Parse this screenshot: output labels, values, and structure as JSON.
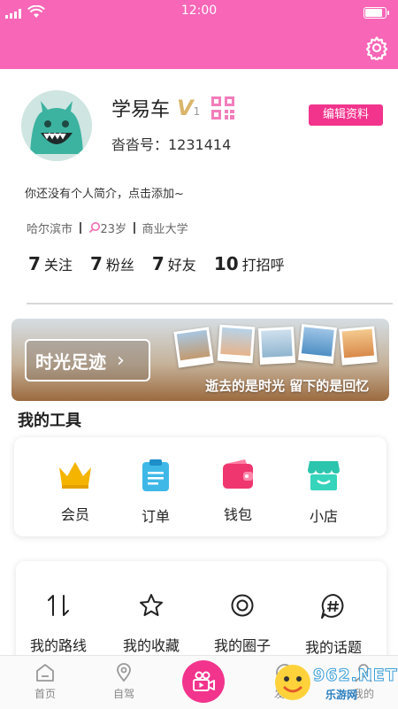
{
  "status": {
    "time": "12:00"
  },
  "header": {
    "settings_icon": "gear-icon"
  },
  "profile": {
    "name": "学易车",
    "vip_badge": "V",
    "vip_level": "1",
    "edit_label": "编辑资料",
    "id_text": "沓沓号：1231414",
    "bio": "你还没有个人简介，点击添加~",
    "city": "哈尔滨市",
    "age": "23岁",
    "school": "商业大学",
    "stats": [
      {
        "num": "7",
        "label": "关注"
      },
      {
        "num": "7",
        "label": "粉丝"
      },
      {
        "num": "7",
        "label": "好友"
      },
      {
        "num": "10",
        "label": "打招呼"
      }
    ]
  },
  "banner": {
    "button_label": "时光足迹",
    "chevron": "›",
    "slogan": "逝去的是时光  留下的是回忆"
  },
  "tools": {
    "title": "我的工具",
    "items": [
      {
        "label": "会员",
        "icon": "crown-icon"
      },
      {
        "label": "订单",
        "icon": "clipboard-icon"
      },
      {
        "label": "钱包",
        "icon": "wallet-icon"
      },
      {
        "label": "小店",
        "icon": "shop-icon"
      }
    ]
  },
  "my": {
    "items": [
      {
        "label": "我的路线",
        "icon": "route-arrows-icon"
      },
      {
        "label": "我的收藏",
        "icon": "star-icon"
      },
      {
        "label": "我的圈子",
        "icon": "circle-icon"
      },
      {
        "label": "我的话题",
        "icon": "hashtag-bubble-icon"
      }
    ]
  },
  "nav": {
    "items": [
      {
        "label": "首页",
        "icon": "home-icon"
      },
      {
        "label": "自驾",
        "icon": "location-pin-icon"
      },
      {
        "label": "",
        "icon": "video-camera-icon"
      },
      {
        "label": "发现",
        "icon": "discover-icon"
      },
      {
        "label": "我的",
        "icon": "user-icon"
      }
    ]
  },
  "watermark": {
    "number": "962.NET",
    "sub": "乐游网"
  },
  "colors": {
    "header": "#f866b7",
    "accent": "#f2348d",
    "teal": "#35c7b0",
    "gold": "#f5b400"
  }
}
